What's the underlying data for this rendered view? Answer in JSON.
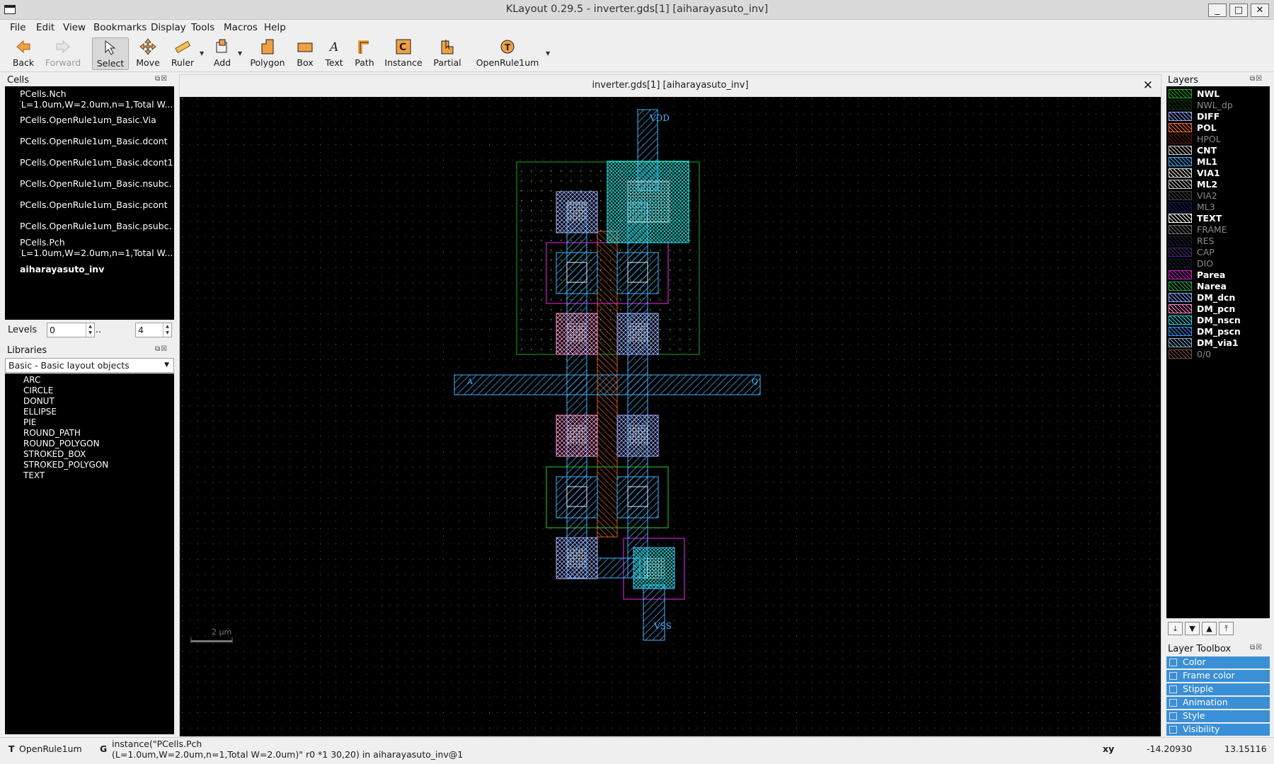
{
  "window": {
    "title": "KLayout 0.29.5 - inverter.gds[1] [aiharayasuto_inv]",
    "minimize": "_",
    "maximize": "□",
    "close": "✕"
  },
  "menu": [
    "File",
    "Edit",
    "View",
    "Bookmarks",
    "Display",
    "Tools",
    "Macros",
    "Help"
  ],
  "toolbar": {
    "back": "Back",
    "forward": "Forward",
    "select": "Select",
    "move": "Move",
    "ruler": "Ruler",
    "add": "Add",
    "polygon": "Polygon",
    "box": "Box",
    "text": "Text",
    "path": "Path",
    "instance": "Instance",
    "partial": "Partial",
    "openrule": "OpenRule1um"
  },
  "cells_panel": {
    "title": "Cells",
    "items": [
      {
        "line1": "PCells.Nch",
        "line2": "(L=1.0um,W=2.0um,n=1,Total W..."
      },
      {
        "line1": "PCells.OpenRule1um_Basic.Via"
      },
      {
        "line1": "PCells.OpenRule1um_Basic.dcont"
      },
      {
        "line1": "PCells.OpenRule1um_Basic.dcont1"
      },
      {
        "line1": "PCells.OpenRule1um_Basic.nsubc..."
      },
      {
        "line1": "PCells.OpenRule1um_Basic.pcont"
      },
      {
        "line1": "PCells.OpenRule1um_Basic.psubc..."
      },
      {
        "line1": "PCells.Pch",
        "line2": "(L=1.0um,W=2.0um,n=1,Total W..."
      },
      {
        "line1": "aiharayasuto_inv"
      }
    ]
  },
  "levels": {
    "label": "Levels",
    "from": "0",
    "sep": "..",
    "to": "4"
  },
  "libraries_panel": {
    "title": "Libraries",
    "selected": "Basic - Basic layout objects",
    "items": [
      "ARC",
      "CIRCLE",
      "DONUT",
      "ELLIPSE",
      "PIE",
      "ROUND_PATH",
      "ROUND_POLYGON",
      "STROKED_BOX",
      "STROKED_POLYGON",
      "TEXT"
    ]
  },
  "canvas": {
    "tab_title": "inverter.gds[1] [aiharayasuto_inv]",
    "close": "✕",
    "labels": {
      "vdd": "VDD",
      "vss": "VSS",
      "a": "A",
      "q": "Q"
    },
    "scale_bar": "2  µm"
  },
  "layers_panel": {
    "title": "Layers",
    "items": [
      {
        "name": "NWL",
        "color": "#22aa22",
        "bold": true
      },
      {
        "name": "NWL_dp",
        "color": "#226622",
        "bold": false
      },
      {
        "name": "DIFF",
        "color": "#9aa8ff",
        "bold": true
      },
      {
        "name": "POL",
        "color": "#ff7030",
        "bold": true
      },
      {
        "name": "HPOL",
        "color": "#993311",
        "bold": false
      },
      {
        "name": "CNT",
        "color": "#cccccc",
        "bold": true
      },
      {
        "name": "ML1",
        "color": "#40b0ff",
        "bold": true
      },
      {
        "name": "VIA1",
        "color": "#e8e8e8",
        "bold": true
      },
      {
        "name": "ML2",
        "color": "#c8c8c8",
        "bold": true
      },
      {
        "name": "VIA2",
        "color": "#777777",
        "bold": false
      },
      {
        "name": "ML3",
        "color": "#2233aa",
        "bold": false
      },
      {
        "name": "TEXT",
        "color": "#ffffff",
        "bold": true
      },
      {
        "name": "FRAME",
        "color": "#cccccc",
        "bold": false
      },
      {
        "name": "RES",
        "color": "#333366",
        "bold": false
      },
      {
        "name": "CAP",
        "color": "#8844cc",
        "bold": false
      },
      {
        "name": "DIO",
        "color": "#223355",
        "bold": false
      },
      {
        "name": "Parea",
        "color": "#cc22cc",
        "bold": true
      },
      {
        "name": "Narea",
        "color": "#22aa44",
        "bold": true
      },
      {
        "name": "DM_dcn",
        "color": "#88aaff",
        "bold": true
      },
      {
        "name": "DM_pcn",
        "color": "#ff88cc",
        "bold": true
      },
      {
        "name": "DM_nscn",
        "color": "#22dddd",
        "bold": true
      },
      {
        "name": "DM_pscn",
        "color": "#3399ff",
        "bold": true
      },
      {
        "name": "DM_via1",
        "color": "#88aacc",
        "bold": true
      },
      {
        "name": "0/0",
        "color": "#dd8877",
        "bold": false
      }
    ]
  },
  "layer_toolbox": {
    "title": "Layer Toolbox",
    "items": [
      "Color",
      "Frame color",
      "Stipple",
      "Animation",
      "Style",
      "Visibility"
    ]
  },
  "status": {
    "t_key": "T",
    "t_value": "OpenRule1um",
    "g_key": "G",
    "g_line1": "instance(\"PCells.Pch",
    "g_line2": "(L=1.0um,W=2.0um,n=1,Total W=2.0um)\" r0 *1 30,20) in aiharayasuto_inv@1",
    "xy_label": "xy",
    "x": "-14.20930",
    "y": "13.15116"
  }
}
